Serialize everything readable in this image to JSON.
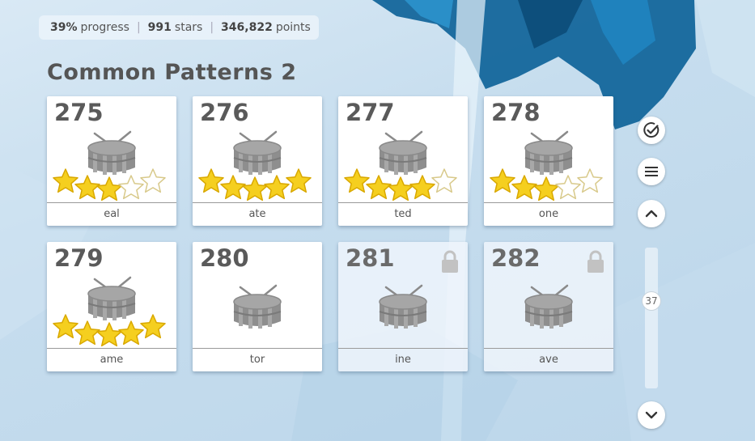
{
  "stats": {
    "progress_value": "39%",
    "progress_label": "progress",
    "stars_value": "991",
    "stars_label": "stars",
    "points_value": "346,822",
    "points_label": "points"
  },
  "set": {
    "title": "Common Patterns 2"
  },
  "levels": [
    {
      "number": "275",
      "label": "eal",
      "stars": 3,
      "locked": false
    },
    {
      "number": "276",
      "label": "ate",
      "stars": 5,
      "locked": false
    },
    {
      "number": "277",
      "label": "ted",
      "stars": 4,
      "locked": false
    },
    {
      "number": "278",
      "label": "one",
      "stars": 3,
      "locked": false
    },
    {
      "number": "279",
      "label": "ame",
      "stars": 5,
      "locked": false
    },
    {
      "number": "280",
      "label": "tor",
      "stars": 0,
      "locked": false
    },
    {
      "number": "281",
      "label": "ine",
      "stars": 0,
      "locked": true
    },
    {
      "number": "282",
      "label": "ave",
      "stars": 0,
      "locked": true
    }
  ],
  "sidebar": {
    "buttons": [
      {
        "icon": "check-circle-icon"
      },
      {
        "icon": "menu-icon"
      },
      {
        "icon": "chevron-up-icon"
      },
      {
        "icon": "chevron-down-icon"
      }
    ],
    "scroll_value": "37"
  },
  "colors": {
    "star_fill": "#f5cf1f",
    "star_empty": "#ffffff",
    "drum_gray": "#9a9a9a",
    "ice_blue": "#1a6fa3"
  }
}
